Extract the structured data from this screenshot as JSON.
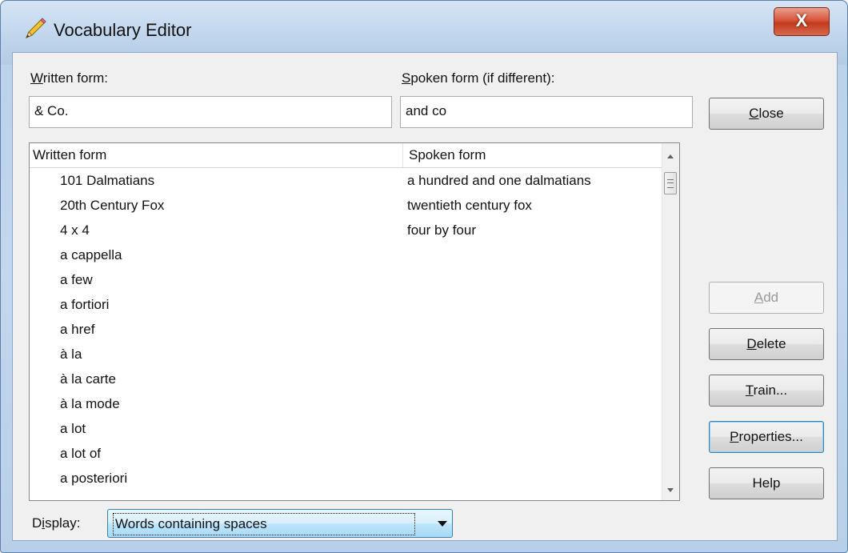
{
  "window": {
    "title": "Vocabulary Editor",
    "close_glyph": "X"
  },
  "fields": {
    "written_label": "Written form:",
    "written_value": "& Co.",
    "spoken_label": "Spoken form (if different):",
    "spoken_value": "and co"
  },
  "list": {
    "col_written": "Written form",
    "col_spoken": "Spoken form",
    "rows": [
      {
        "written": "101 Dalmatians",
        "spoken": "a hundred and one dalmatians"
      },
      {
        "written": "20th Century Fox",
        "spoken": "twentieth century fox"
      },
      {
        "written": "4 x 4",
        "spoken": "four by four"
      },
      {
        "written": "a cappella",
        "spoken": ""
      },
      {
        "written": "a few",
        "spoken": ""
      },
      {
        "written": "a fortiori",
        "spoken": ""
      },
      {
        "written": "a href",
        "spoken": ""
      },
      {
        "written": "à la",
        "spoken": ""
      },
      {
        "written": "à la carte",
        "spoken": ""
      },
      {
        "written": "à la mode",
        "spoken": ""
      },
      {
        "written": "a lot",
        "spoken": ""
      },
      {
        "written": "a lot of",
        "spoken": ""
      },
      {
        "written": "a posteriori",
        "spoken": ""
      }
    ]
  },
  "buttons": {
    "close": "Close",
    "add": "Add",
    "delete": "Delete",
    "train": "Train...",
    "properties": "Properties...",
    "help": "Help"
  },
  "display": {
    "label": "Display:",
    "selected": "Words containing spaces"
  },
  "colors": {
    "close_button": "#d9553b",
    "combo_accent": "#3c7fb1"
  },
  "icons": {
    "title": "pencil-icon"
  }
}
